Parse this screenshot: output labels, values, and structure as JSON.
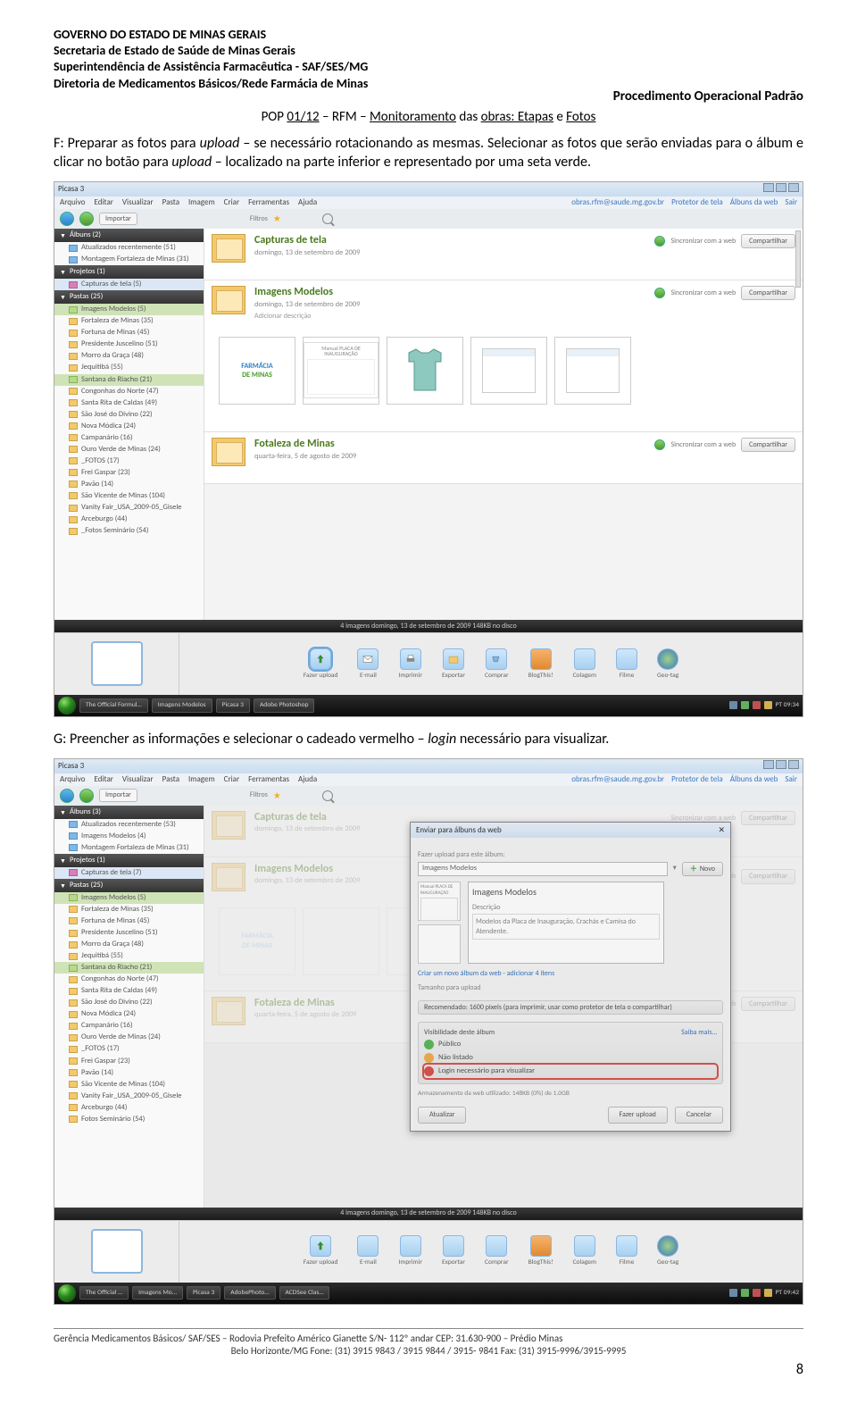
{
  "header": {
    "l1": "GOVERNO DO ESTADO DE MINAS GERAIS",
    "l2": "Secretaria de Estado de Saúde de Minas Gerais",
    "l3": "Superintendência de Assistência Farmacêutica - SAF/SES/MG",
    "l4": "Diretoria de Medicamentos Básicos/Rede Farmácia de Minas",
    "proc": "Procedimento Operacional Padrão",
    "pop_pre": "POP ",
    "pop_code": "01/12",
    "pop_mid1": " – RFM – ",
    "pop_mid1b": "Monitoramento",
    "pop_mid2": " das ",
    "pop_mid2b": "obras:",
    "pop_mid3": " Etapas",
    "pop_mid4": " e ",
    "pop_mid5": "Fotos"
  },
  "paraF_a": "F: Preparar as fotos para ",
  "paraF_b": "upload",
  "paraF_c": " – se necessário rotacionando as mesmas. Selecionar as fotos que serão enviadas para o álbum e clicar no botão para ",
  "paraF_d": "upload",
  "paraF_e": " – localizado na parte inferior e representado por uma seta verde.",
  "paraG_a": "G: Preencher as informações e selecionar o cadeado vermelho – ",
  "paraG_b": "login",
  "paraG_c": " necessário para visualizar.",
  "app": {
    "title": "Picasa 3",
    "menu": [
      "Arquivo",
      "Editar",
      "Visualizar",
      "Pasta",
      "Imagem",
      "Criar",
      "Ferramentas",
      "Ajuda"
    ],
    "toprightUser": "obras.rfm@saude.mg.gov.br",
    "toprightLinks": [
      "Protetor de tela",
      "Álbuns da web",
      "Sair"
    ],
    "toolbar": {
      "importar": "Importar",
      "filtros": "Filtros"
    },
    "sidebar": {
      "albuns1": "Álbuns (2)",
      "albuns2": "Álbuns (3)",
      "a_items1": [
        {
          "t": "Atualizados recentemente (51)",
          "ic": "pic"
        },
        {
          "t": "Montagem Fortaleza de Minas (31)",
          "ic": "pic"
        }
      ],
      "a_items2": [
        {
          "t": "Atualizados recentemente (53)",
          "ic": "pic"
        },
        {
          "t": "Imagens Modelos (4)",
          "ic": "pic"
        },
        {
          "t": "Montagem Fortaleza de Minas (31)",
          "ic": "pic"
        }
      ],
      "projetos": "Projetos (1)",
      "p_items1": [
        {
          "t": "Capturas de tela (5)",
          "ic": "film"
        }
      ],
      "p_items2": [
        {
          "t": "Capturas de tela (7)",
          "ic": "film"
        }
      ],
      "pastas": "Pastas (25)",
      "f_sel": "Imagens Modelos (5)",
      "f_items": [
        {
          "t": "Fortaleza de Minas (35)"
        },
        {
          "t": "Fortuna de Minas (45)"
        },
        {
          "t": "Presidente Juscelino (51)"
        },
        {
          "t": "Morro da Graça (48)"
        },
        {
          "t": "Jequitibá (55)"
        },
        {
          "t": "Santana do Riacho (21)",
          "hl": true
        },
        {
          "t": "Congonhas do Norte (47)"
        },
        {
          "t": "Santa Rita de Caldas (49)"
        },
        {
          "t": "São José do Divino (22)"
        },
        {
          "t": "Nova Módica (24)"
        },
        {
          "t": "Campanário (16)"
        },
        {
          "t": "Ouro Verde de Minas (24)"
        },
        {
          "t": "_FOTOS (17)"
        },
        {
          "t": "Frei Gaspar (23)"
        },
        {
          "t": "Pavão (14)"
        },
        {
          "t": "São Vicente de Minas (104)"
        },
        {
          "t": "Vanity Fair_USA_2009-05_Gisele"
        },
        {
          "t": "Arceburgo (44)"
        },
        {
          "t": "_Fotos Seminário (54)"
        }
      ],
      "f_last2": "Fotos Seminário (54)"
    },
    "albums": {
      "capturas": {
        "title": "Capturas de tela",
        "sub": "domingo, 13 de setembro de 2009"
      },
      "modelos": {
        "title": "Imagens Modelos",
        "sub": "domingo, 13 de setembro de 2009",
        "desc": "Adicionar descrição"
      },
      "fortaleza": {
        "title": "Fotaleza de Minas",
        "sub": "quarta-feira, 5 de agosto de 2009"
      },
      "sync": "Sincronizar com a web",
      "share": "Compartilhar",
      "logo1": "FARMÁCIA",
      "logo2": "DE MINAS",
      "placa": "Manual PLACA DE INAUGURAÇÃO"
    },
    "status": "4 imagens   domingo, 13 de setembro de 2009   148KB no disco",
    "tools": [
      "Fazer upload",
      "E-mail",
      "Imprimir",
      "Exportar",
      "Comprar",
      "BlogThis!",
      "Colagem",
      "Filme",
      "Geo-tag"
    ],
    "taskbar": {
      "items1": [
        "The Official Formul…",
        "Imagens Modelos",
        "Picasa 3",
        "Adobe Photoshop"
      ],
      "items2": [
        "The Official …",
        "Imagens Mo…",
        "Picasa 3",
        "AdobePhoto…",
        "ACDSee Clas…"
      ],
      "tray1": "PT   09:34",
      "tray2": "PT   09:42"
    }
  },
  "modal": {
    "title": "Enviar para álbuns da web",
    "lbl_upload": "Fazer upload para este álbum:",
    "album_sel": "Imagens Modelos",
    "novo": "Novo",
    "big_title": "Imagens Modelos",
    "big_desc_lbl": "Descrição",
    "big_desc": "Modelos da Placa de Inauguração, Crachás e Camisa do Atendente.",
    "newlink": "Criar um novo álbum da web - adicionar 4 itens",
    "tam_lbl": "Tamanho para upload",
    "tam_val": "Recomendado: 1600 pixels (para imprimir, usar como protetor de tela o compartilhar)",
    "vis_lbl": "Visibilidade deste álbum",
    "saiba": "Saiba mais…",
    "vis": [
      {
        "t": "Público",
        "c": "green"
      },
      {
        "t": "Não listado",
        "c": "orange"
      },
      {
        "t": "Login necessário para visualizar",
        "c": "red",
        "sel": true
      }
    ],
    "storage": "Armazenamento da web utilizado: 148KB (0%) de 1.0GB",
    "atualizar": "Atualizar",
    "ok": "Fazer upload",
    "cancel": "Cancelar",
    "placa": "Manual PLACA DE INAUGURAÇÃO"
  },
  "footer": {
    "l1": "Gerência Medicamentos Básicos/ SAF/SES – Rodovia Prefeito Américo Gianette S/N- 112º andar     CEP: 31.630-900 – Prédio Minas",
    "l2": "Belo Horizonte/MG Fone: (31) 3915 9843 / 3915 9844 / 3915- 9841 Fax: (31) 3915-9996/3915-9995",
    "page": "8"
  }
}
